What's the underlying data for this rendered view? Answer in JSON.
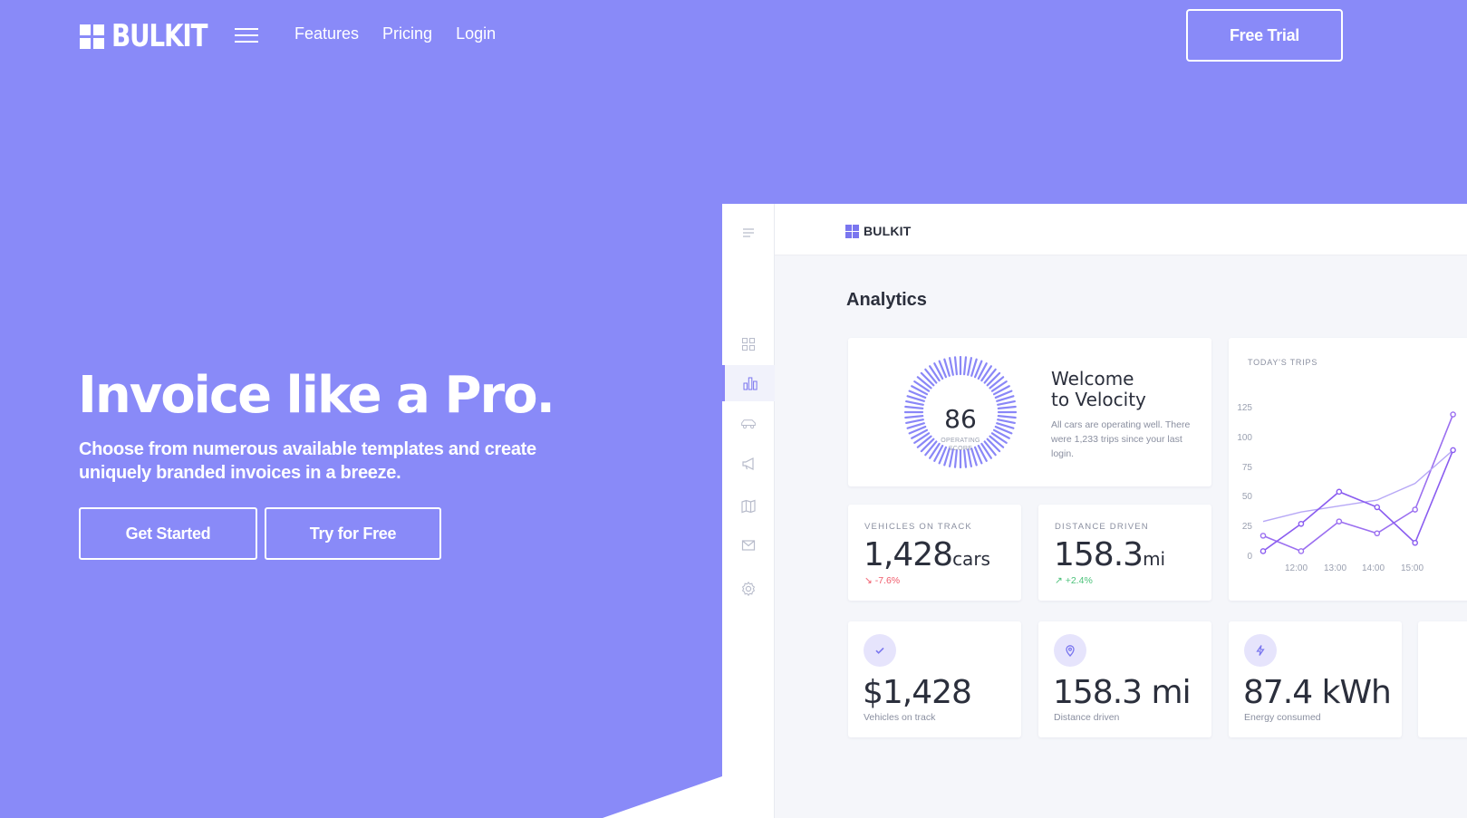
{
  "nav": {
    "brand": "BULKIT",
    "links": [
      "Features",
      "Pricing",
      "Login"
    ],
    "cta": "Free Trial"
  },
  "hero": {
    "title": "Invoice like a Pro.",
    "subtitle": "Choose from numerous available templates and create uniquely branded invoices in a breeze.",
    "primary_button": "Get Started",
    "secondary_button": "Try for Free"
  },
  "dashboard": {
    "brand": "BULKIT",
    "title": "Analytics",
    "sidebar_icons": [
      "menu-icon",
      "grid-icon",
      "bar-chart-icon",
      "car-icon",
      "megaphone-icon",
      "map-icon",
      "mail-icon",
      "settings-icon"
    ],
    "welcome": {
      "score": "86",
      "score_label_1": "OPERATING",
      "score_label_2": "SCORE",
      "title_line1": "Welcome",
      "title_line2": "to Velocity",
      "text": "All cars are operating well. There were 1,233 trips since your last login."
    },
    "vehicles": {
      "label": "VEHICLES ON TRACK",
      "value": "1,428",
      "unit": "cars",
      "delta": "↘ -7.6%"
    },
    "distance": {
      "label": "DISTANCE DRIVEN",
      "value": "158.3",
      "unit": "mi",
      "delta": "↗ +2.4%"
    },
    "stats": [
      {
        "value": "$1,428",
        "label": "Vehicles on track",
        "icon": "check-icon"
      },
      {
        "value": "158.3 mi",
        "label": "Distance driven",
        "icon": "location-pin-icon"
      },
      {
        "value": "87.4 kWh",
        "label": "Energy consumed",
        "icon": "lightning-icon"
      }
    ],
    "colors": {
      "accent": "#898af8",
      "positive": "#4cc27a",
      "negative": "#f05a6a"
    }
  },
  "chart_data": {
    "type": "line",
    "title": "TODAY'S TRIPS",
    "x_ticks": [
      "12:00",
      "13:00",
      "14:00",
      "15:00"
    ],
    "y_ticks": [
      0,
      25,
      50,
      75,
      100,
      125
    ],
    "ylim": [
      0,
      125
    ],
    "series": [
      {
        "values": [
          18,
          5,
          30,
          20,
          40,
          120
        ]
      },
      {
        "values": [
          30,
          38,
          43,
          48,
          62,
          90
        ]
      },
      {
        "values": [
          5,
          28,
          55,
          42,
          12,
          90
        ]
      }
    ]
  }
}
